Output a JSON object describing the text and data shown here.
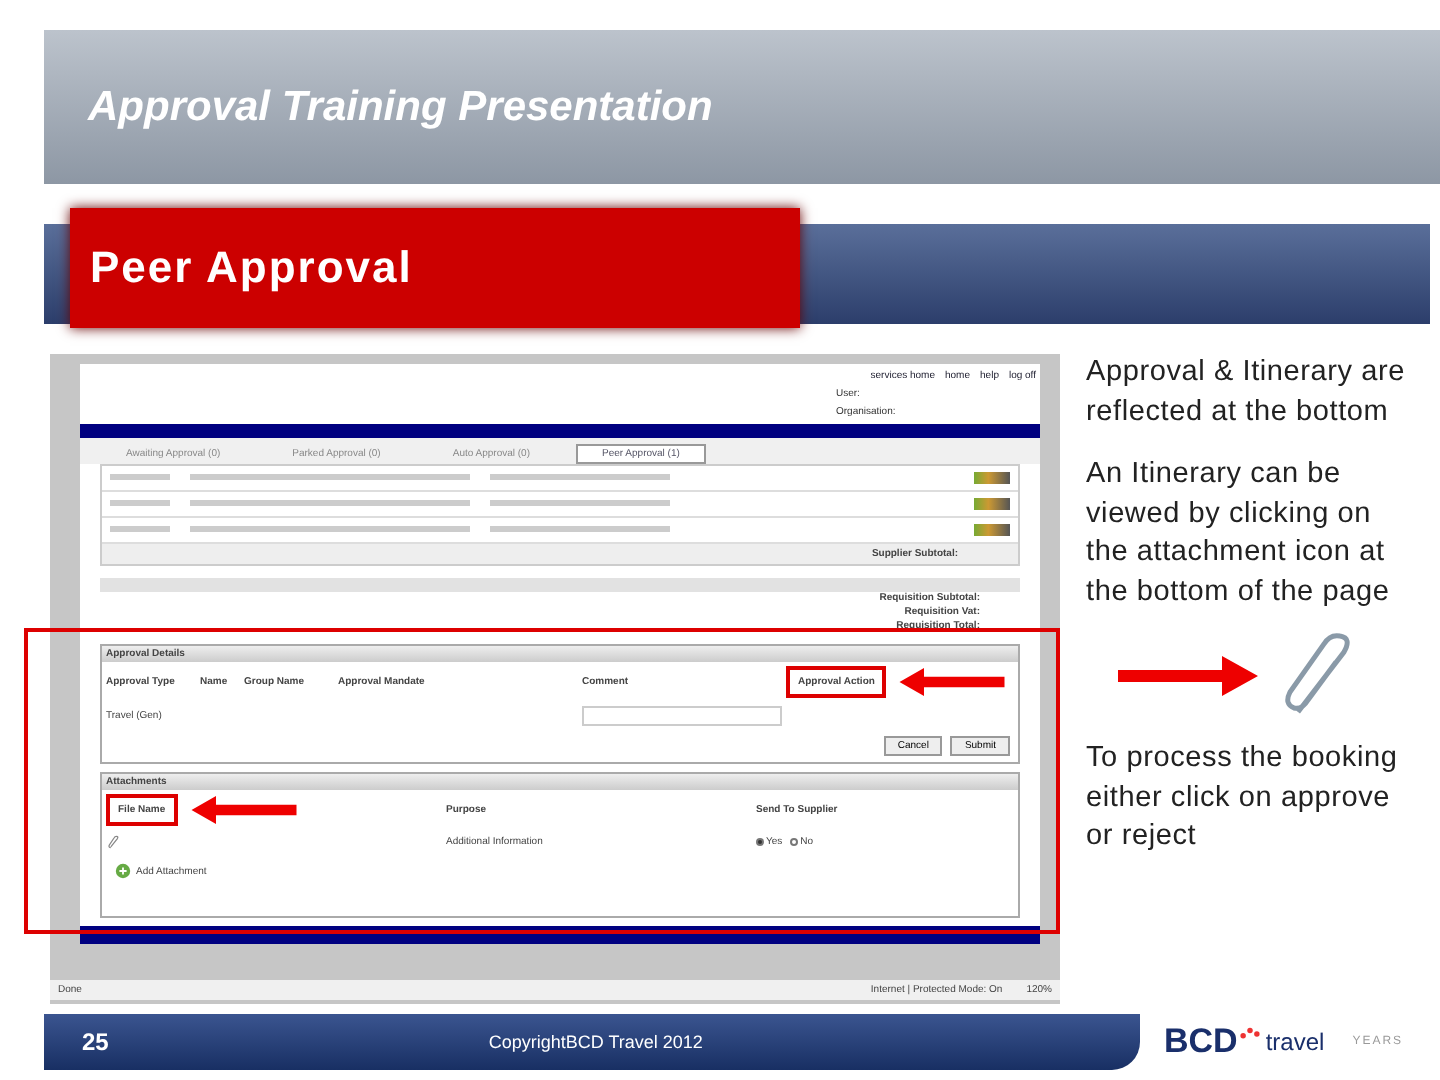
{
  "header": {
    "title": "Approval Training Presentation"
  },
  "section_title": "Peer Approval",
  "screenshot": {
    "top_links": [
      "services home",
      "home",
      "help",
      "log off"
    ],
    "user_labels": [
      "User:",
      "Organisation:"
    ],
    "tabs": [
      {
        "label": "Awaiting Approval (0)",
        "selected": false
      },
      {
        "label": "Parked Approval (0)",
        "selected": false
      },
      {
        "label": "Auto Approval (0)",
        "selected": false
      },
      {
        "label": "Peer Approval (1)",
        "selected": true
      }
    ],
    "supplier_subtotal_label": "Supplier Subtotal:",
    "totals_labels": [
      "Requisition Subtotal:",
      "Requisition Vat:",
      "Requisition Total:"
    ],
    "approval_details": {
      "title": "Approval Details",
      "columns": [
        "Approval Type",
        "Name",
        "Group Name",
        "Approval Mandate",
        "Comment",
        "Approval Action"
      ],
      "approval_type": "Travel (Gen)",
      "buttons": [
        "Cancel",
        "Submit"
      ]
    },
    "attachments": {
      "title": "Attachments",
      "columns": [
        "File Name",
        "Purpose",
        "Send To Supplier"
      ],
      "purpose": "Additional Information",
      "send_to_supplier": [
        {
          "label": "Yes",
          "selected": true
        },
        {
          "label": "No",
          "selected": false
        }
      ],
      "add_label": "Add Attachment"
    },
    "status_bar": {
      "left": "Done",
      "zone": "Internet | Protected Mode: On",
      "zoom": "120%"
    }
  },
  "notes": [
    "Approval & Itinerary are reflected at the bottom",
    "An Itinerary can be viewed by clicking on the attachment icon at the bottom of the page",
    "To process the booking either click on approve or reject"
  ],
  "footer": {
    "page": "25",
    "copyright": "CopyrightBCD Travel 2012"
  },
  "logo": {
    "brand": "BCD",
    "word": "travel",
    "years": "YEARS"
  }
}
